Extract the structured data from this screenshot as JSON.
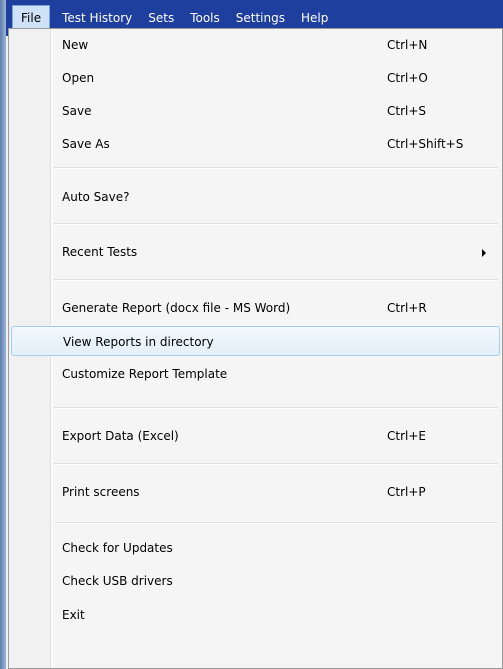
{
  "menubar": {
    "items": [
      {
        "label": "File"
      },
      {
        "label": "Test History"
      },
      {
        "label": "Sets"
      },
      {
        "label": "Tools"
      },
      {
        "label": "Settings"
      },
      {
        "label": "Help"
      }
    ]
  },
  "file_menu": {
    "new": {
      "label": "New",
      "shortcut": "Ctrl+N"
    },
    "open": {
      "label": "Open",
      "shortcut": "Ctrl+O"
    },
    "save": {
      "label": "Save",
      "shortcut": "Ctrl+S"
    },
    "save_as": {
      "label": "Save As",
      "shortcut": "Ctrl+Shift+S"
    },
    "auto_save": {
      "label": "Auto Save?"
    },
    "recent_tests": {
      "label": "Recent Tests"
    },
    "generate_report": {
      "label": "Generate Report (docx file - MS Word)",
      "shortcut": "Ctrl+R"
    },
    "view_reports": {
      "label": "View Reports in directory"
    },
    "customize_template": {
      "label": "Customize Report Template"
    },
    "export_data": {
      "label": "Export Data (Excel)",
      "shortcut": "Ctrl+E"
    },
    "print_screens": {
      "label": "Print screens",
      "shortcut": "Ctrl+P"
    },
    "check_updates": {
      "label": "Check for Updates"
    },
    "check_usb": {
      "label": "Check USB drivers"
    },
    "exit": {
      "label": "Exit"
    }
  },
  "colors": {
    "menubar_bg": "#1f3f9f",
    "highlight_border": "#a9cbea"
  }
}
